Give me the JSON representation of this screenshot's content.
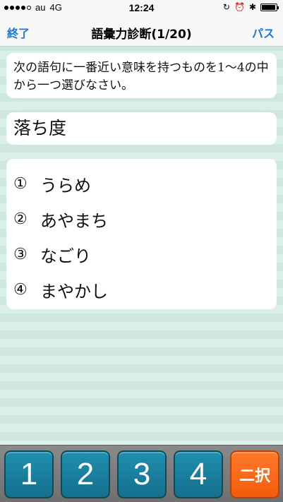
{
  "status": {
    "carrier": "au",
    "network": "4G",
    "time": "12:24",
    "battery_level": 0.95
  },
  "nav": {
    "left_label": "終了",
    "title": "語彙力診断(1/20)",
    "right_label": "パス"
  },
  "question": {
    "prompt": "次の語句に一番近い意味を持つものを1〜4の中から一つ選びなさい。",
    "word": "落ち度"
  },
  "choices": [
    {
      "num": "①",
      "text": "うらめ"
    },
    {
      "num": "②",
      "text": "あやまち"
    },
    {
      "num": "③",
      "text": "なごり"
    },
    {
      "num": "④",
      "text": "まやかし"
    }
  ],
  "buttons": {
    "b1": "1",
    "b2": "2",
    "b3": "3",
    "b4": "4",
    "two_choice": "二択"
  },
  "colors": {
    "accent": "#1a7bd6",
    "answer_button": "#1a86a8",
    "two_choice_button": "#f76a1a"
  }
}
